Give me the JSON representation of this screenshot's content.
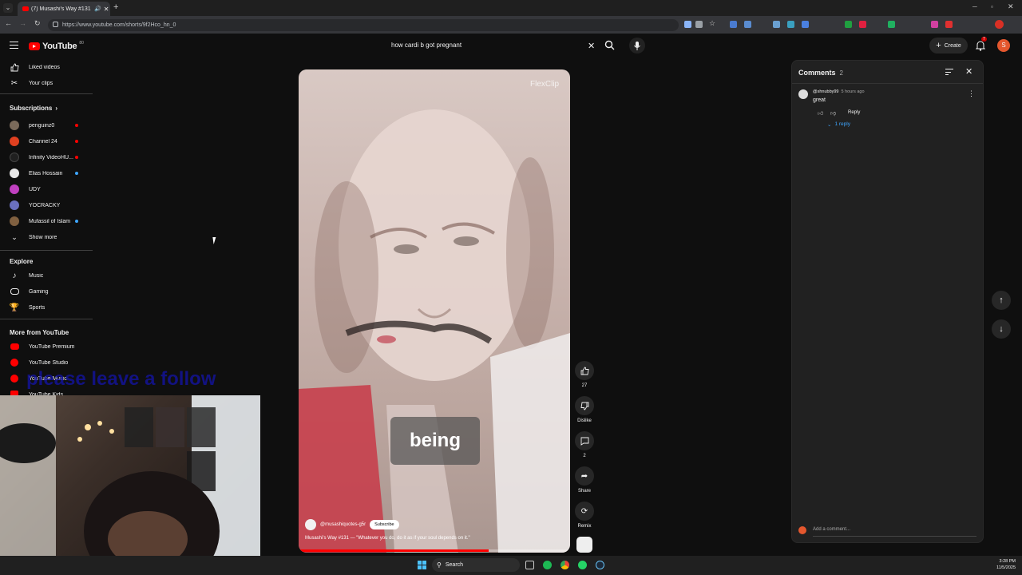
{
  "browser": {
    "tab_title": "(7) Musashi's Way #131 - \"W",
    "url": "https://www.youtube.com/shorts/9f2Hco_hn_0"
  },
  "masthead": {
    "logo_text": "YouTube",
    "country": "80",
    "search_value": "how cardi b got pregnant",
    "create_label": "Create",
    "notif_count": "7",
    "user_initial": "S"
  },
  "sidebar": {
    "top_items": [
      {
        "label": "Liked videos",
        "icon": "thumb-up-icon"
      },
      {
        "label": "Your clips",
        "icon": "scissors-icon"
      }
    ],
    "subscriptions_title": "Subscriptions",
    "subscriptions": [
      {
        "label": "penguinz0",
        "color": "#7a6a5a",
        "dot": "#ff0000"
      },
      {
        "label": "Channel 24",
        "color": "#e04020",
        "dot": "#ff0000"
      },
      {
        "label": "Infinity VideoHU...",
        "color": "#202020",
        "dot": "#ff0000"
      },
      {
        "label": "Elias Hossain",
        "color": "#e8e8e8",
        "dot": "#3ea6ff"
      },
      {
        "label": "UDY",
        "color": "#c040c0",
        "dot": ""
      },
      {
        "label": "YOCRACKY",
        "color": "#6a70c0",
        "dot": ""
      },
      {
        "label": "Mufassil of Islam",
        "color": "#806040",
        "dot": "#3ea6ff"
      }
    ],
    "show_more": "Show more",
    "explore_title": "Explore",
    "explore": [
      {
        "label": "Music",
        "icon": "music-icon"
      },
      {
        "label": "Gaming",
        "icon": "gaming-icon"
      },
      {
        "label": "Sports",
        "icon": "trophy-icon"
      }
    ],
    "more_title": "More from YouTube",
    "more": [
      {
        "label": "YouTube Premium"
      },
      {
        "label": "YouTube Studio"
      },
      {
        "label": "YouTube Music"
      },
      {
        "label": "YouTube Kids"
      }
    ]
  },
  "overlay_text": "please leave a follow",
  "short": {
    "watermark": "FlexClip",
    "caption": "being",
    "channel": "@musashiquotes-g5r",
    "subscribe": "Subscribe",
    "title": "Musashi's Way #131 — \"Whatever you do, do it as if your soul depends on it.\"",
    "progress": 0.7
  },
  "actions": {
    "likes": "27",
    "dislike": "Dislike",
    "comments": "2",
    "share": "Share",
    "remix": "Remix"
  },
  "comments_panel": {
    "title": "Comments",
    "count": "2",
    "comment": {
      "author": "@shnubby99",
      "time": "5 hours ago",
      "text": "great",
      "reply_label": "Reply",
      "replies": "1 reply"
    },
    "add_placeholder": "Add a comment..."
  },
  "taskbar": {
    "search": "Search",
    "time": "3:28 PM",
    "date": "11/5/2025"
  }
}
